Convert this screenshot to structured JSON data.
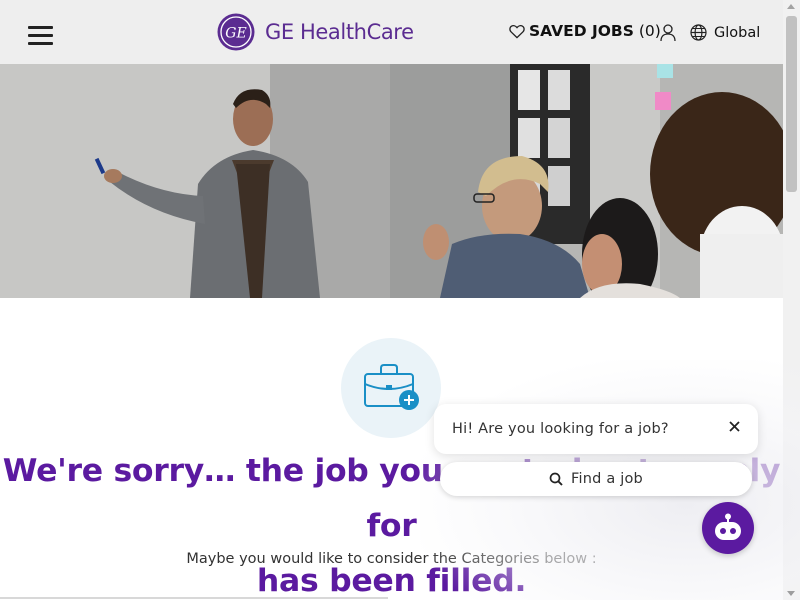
{
  "header": {
    "menu_icon": "hamburger-menu-icon",
    "logo_icon": "ge-monogram-logo",
    "logo_text": "GE HealthCare",
    "saved_jobs_label": "SAVED JOBS",
    "saved_jobs_count": "(0)",
    "user_icon": "user-icon",
    "global_label": "Global",
    "brand_color": "#5b2c91"
  },
  "hero": {
    "image": "office-meeting-presenter-at-whiteboard-photo"
  },
  "main": {
    "icon": "briefcase-plus-icon",
    "heading_line1": "We're sorry… the job you are trying to apply for",
    "heading_line2": "has been filled.",
    "subtext": "Maybe you would like to consider the Categories below :",
    "heading_color": "#5b1aa0"
  },
  "chat": {
    "message": "Hi! Are you looking for a job?",
    "find_label": "Find a job",
    "close_icon": "close-icon",
    "search_icon": "search-icon",
    "bot_icon": "chatbot-icon",
    "bot_color": "#5b1aa0"
  }
}
